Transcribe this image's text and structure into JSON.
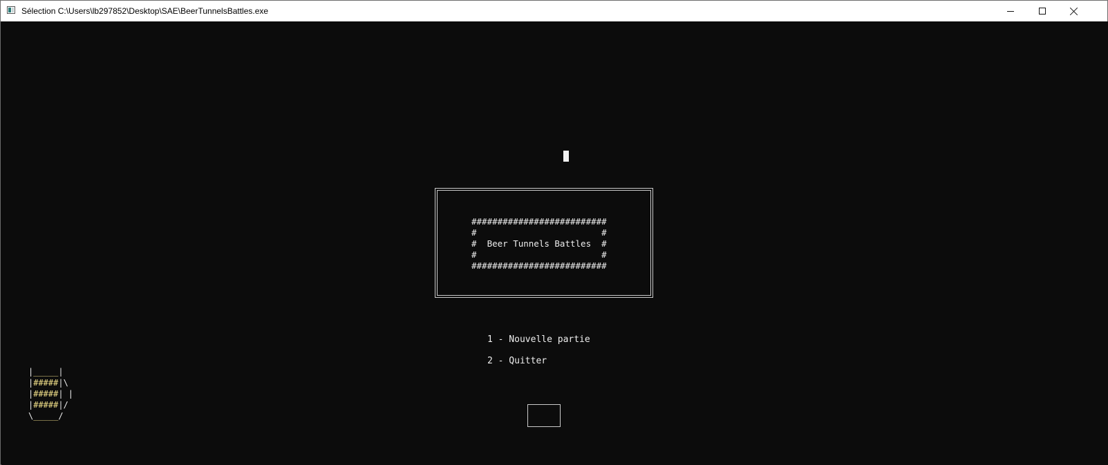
{
  "window": {
    "title": "Sélection C:\\Users\\lb297852\\Desktop\\SAE\\BeerTunnelsBattles.exe",
    "controls": {
      "minimize": "minimize-icon",
      "maximize": "maximize-icon",
      "close": "close-icon"
    }
  },
  "banner": {
    "lines": [
      "##########################",
      "#                        #",
      "#  Beer Tunnels Battles  #",
      "#                        #",
      "##########################"
    ]
  },
  "menu": {
    "items": [
      {
        "label": "1 - Nouvelle partie"
      },
      {
        "label": "2 - Quitter"
      }
    ]
  },
  "input": {
    "value": ""
  },
  "beer_art": {
    "lines": [
      {
        "pre": "|",
        "beer": "_____",
        "post": "|"
      },
      {
        "pre": "|",
        "beer": "#####",
        "post": "|\\"
      },
      {
        "pre": "|",
        "beer": "#####",
        "post": "| |"
      },
      {
        "pre": "|",
        "beer": "#####",
        "post": "|/"
      },
      {
        "pre": "\\",
        "beer": "_____",
        "post": "/"
      }
    ]
  },
  "colors": {
    "console_bg": "#0c0c0c",
    "text": "#eeeeee",
    "beer": "#f1e08a",
    "titlebar_bg": "#ffffff"
  }
}
